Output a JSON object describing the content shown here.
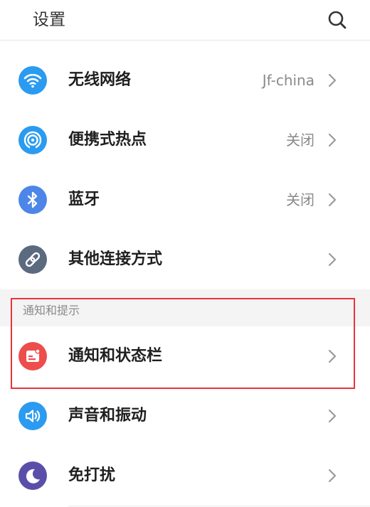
{
  "header": {
    "title": "设置",
    "search_icon": "search-icon"
  },
  "connection_items": [
    {
      "label": "无线网络",
      "value": "Jf-china",
      "icon": "wifi-icon",
      "color": "#2a9bf0"
    },
    {
      "label": "便携式热点",
      "value": "关闭",
      "icon": "hotspot-icon",
      "color": "#2a9bf0"
    },
    {
      "label": "蓝牙",
      "value": "关闭",
      "icon": "bluetooth-icon",
      "color": "#4d86e8"
    },
    {
      "label": "其他连接方式",
      "value": "",
      "icon": "link-icon",
      "color": "#5b6a7e"
    }
  ],
  "section": {
    "title": "通知和提示"
  },
  "notification_items": [
    {
      "label": "通知和状态栏",
      "value": "",
      "icon": "notification-icon",
      "color": "#ee4d4d"
    },
    {
      "label": "声音和振动",
      "value": "",
      "icon": "volume-icon",
      "color": "#2a9bf0"
    },
    {
      "label": "免打扰",
      "value": "",
      "icon": "moon-icon",
      "color": "#5a4fa8"
    }
  ],
  "highlight": {
    "color": "#e8333c",
    "target": "通知和状态栏"
  }
}
